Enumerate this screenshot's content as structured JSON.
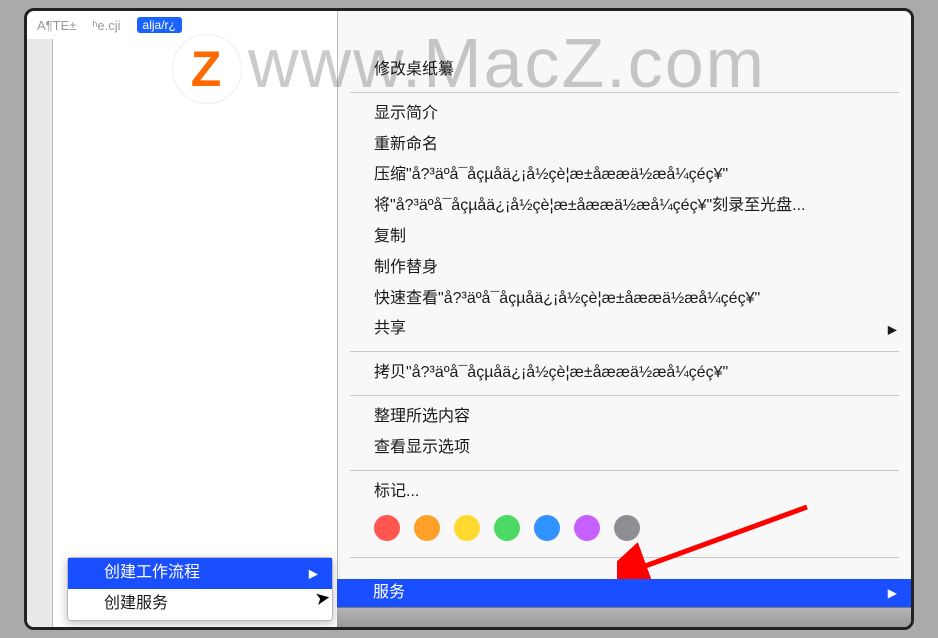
{
  "watermark": {
    "logo": "Z",
    "text": "www.MacZ.com"
  },
  "finder_bar": {
    "left": "A¶TE±",
    "mid": "ʰe.cji",
    "selected": "alja/r¿"
  },
  "garbled": "å?³äºå¯åçµåä¿¡å½çè¦æ±åææä½æå¼çéç¥",
  "context_menu": {
    "change_wallpaper": "修改桌纸纂",
    "get_info": "显示简介",
    "rename": "重新命名",
    "compress_prefix": "压缩\"",
    "compress_suffix": "\"",
    "burn_prefix": "将\"",
    "burn_suffix": "\"刻录至光盘...",
    "duplicate": "复制",
    "make_alias": "制作替身",
    "quicklook_prefix": "快速查看\"",
    "quicklook_suffix": "\"",
    "share": "共享",
    "copy_prefix": "拷贝\"",
    "copy_suffix": "\"",
    "cleanup": "整理所选内容",
    "view_options": "查看显示选项",
    "tags": "标记...",
    "services": "服务"
  },
  "tag_colors": [
    "#ff5650",
    "#ffa028",
    "#ffd92e",
    "#4cd964",
    "#3093ff",
    "#c661ff",
    "#8e8e93"
  ],
  "submenu": {
    "create_workflow": "创建工作流程",
    "create_service": "创建服务"
  }
}
